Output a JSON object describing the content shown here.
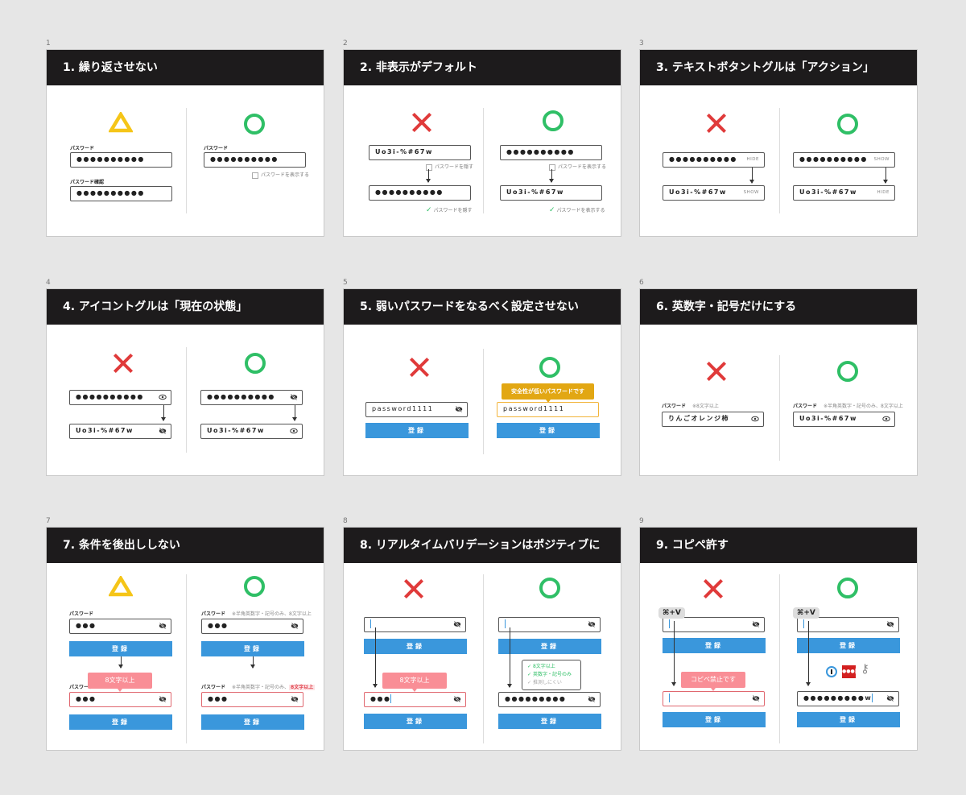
{
  "panels": [
    {
      "number": "1",
      "title": "1. 繰り返させない",
      "left": {
        "label1": "パスワード",
        "value1": "●●●●●●●●●●",
        "label2": "パスワード確認",
        "value2": "●●●●●●●●●●"
      },
      "right": {
        "label": "パスワード",
        "value": "●●●●●●●●●●",
        "checkbox": "パスワードを表示する"
      }
    },
    {
      "number": "2",
      "title": "2. 非表示がデフォルト",
      "left": {
        "value1": "Uo3i-%#67w",
        "checkbox1": "パスワードを隠す",
        "value2": "●●●●●●●●●●",
        "checkbox2": "パスワードを隠す"
      },
      "right": {
        "value1": "●●●●●●●●●●",
        "checkbox1": "パスワードを表示する",
        "value2": "Uo3i-%#67w",
        "checkbox2": "パスワードを表示する"
      }
    },
    {
      "number": "3",
      "title": "3. テキストボタントグルは「アクション」",
      "left": {
        "value1": "●●●●●●●●●●",
        "toggle1": "HIDE",
        "value2": "Uo3i-%#67w",
        "toggle2": "SHOW"
      },
      "right": {
        "value1": "●●●●●●●●●●",
        "toggle1": "SHOW",
        "value2": "Uo3i-%#67w",
        "toggle2": "HIDE"
      }
    },
    {
      "number": "4",
      "title": "4. アイコントグルは「現在の状態」",
      "left": {
        "value1": "●●●●●●●●●●",
        "value2": "Uo3i-%#67w"
      },
      "right": {
        "value1": "●●●●●●●●●●",
        "value2": "Uo3i-%#67w"
      }
    },
    {
      "number": "5",
      "title": "5. 弱いパスワードをなるべく設定させない",
      "left": {
        "value": "password1111",
        "button": "登録"
      },
      "right": {
        "tooltip": "安全性が低いパスワードです",
        "value": "password1111",
        "button": "登録"
      }
    },
    {
      "number": "6",
      "title": "6. 英数字・記号だけにする",
      "left": {
        "label": "パスワード",
        "note": "※8文字以上",
        "value": "りんごオレンジ柿"
      },
      "right": {
        "label": "パスワード",
        "note": "※半角英数字・記号のみ、8文字以上",
        "value": "Uo3i-%#67w"
      }
    },
    {
      "number": "7",
      "title": "7. 条件を後出ししない",
      "left": {
        "label": "パスワード",
        "value": "●●●",
        "button": "登録",
        "tooltip": "8文字以上",
        "label2": "パスワード",
        "value2": "●●●",
        "button2": "登録"
      },
      "right": {
        "label": "パスワード",
        "note": "※半角英数字・記号のみ、8文字以上",
        "value": "●●●",
        "button": "登録",
        "label2": "パスワード",
        "note2": "※半角英数字・記号のみ、",
        "note2_highlight": "8文字以上",
        "value2": "●●●",
        "button2": "登録"
      }
    },
    {
      "number": "8",
      "title": "8. リアルタイムバリデーションはポジティブに",
      "left": {
        "button": "登録",
        "tooltip": "8文字以上",
        "value2": "●●●",
        "button2": "登録"
      },
      "right": {
        "button": "登録",
        "checks": [
          "8文字以上",
          "英数字・記号のみ",
          "推測しにくい"
        ],
        "value2": "●●●●●●●●●",
        "button2": "登録"
      }
    },
    {
      "number": "9",
      "title": "9. コピペ許す",
      "left": {
        "shortcut": "⌘+V",
        "button": "登録",
        "tooltip": "コピペ禁止です",
        "button2": "登録"
      },
      "right": {
        "shortcut": "⌘+V",
        "button": "登録",
        "value2": "●●●●●●●●●w",
        "button2": "登録"
      }
    }
  ],
  "colors": {
    "header": "#1d1b1c",
    "ok": "#2fbf66",
    "ng": "#e03a3a",
    "warn": "#f5c518",
    "button": "#3a97dc",
    "error_tip": "#f98e96"
  }
}
